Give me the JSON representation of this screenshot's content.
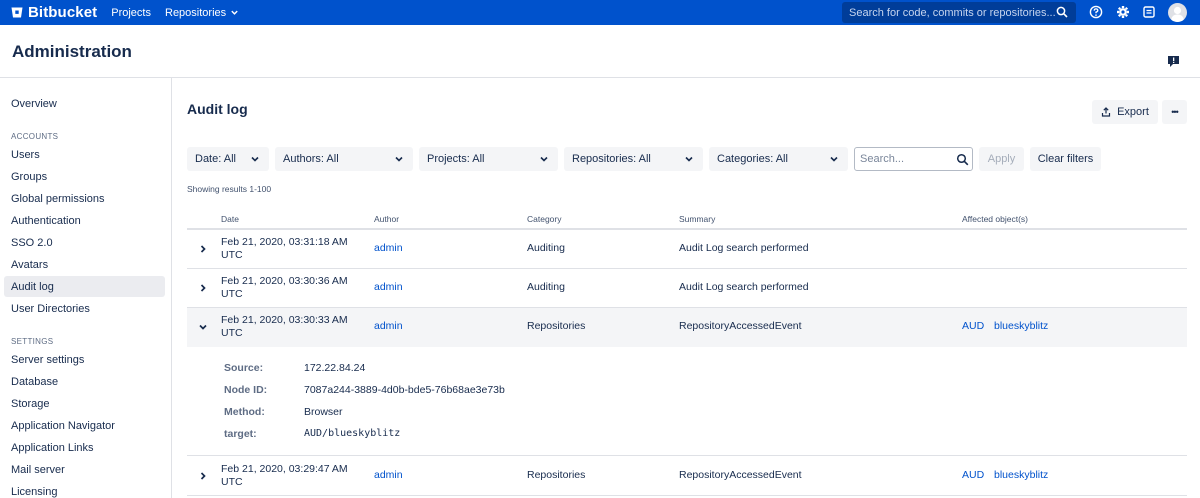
{
  "topnav": {
    "brand": "Bitbucket",
    "projects": "Projects",
    "repositories": "Repositories",
    "search_placeholder": "Search for code, commits or repositories..."
  },
  "admin": {
    "title": "Administration"
  },
  "sidebar": {
    "overview": "Overview",
    "accounts_heading": "ACCOUNTS",
    "accounts": [
      "Users",
      "Groups",
      "Global permissions",
      "Authentication",
      "SSO 2.0",
      "Avatars",
      "Audit log",
      "User Directories"
    ],
    "settings_heading": "SETTINGS",
    "settings": [
      "Server settings",
      "Database",
      "Storage",
      "Application Navigator",
      "Application Links",
      "Mail server",
      "Licensing"
    ],
    "active": "Audit log"
  },
  "main": {
    "title": "Audit log",
    "export_label": "Export",
    "more_label": "•••",
    "filters": {
      "date": "Date: All",
      "authors": "Authors: All",
      "projects": "Projects: All",
      "repositories": "Repositories: All",
      "categories": "Categories: All",
      "search_placeholder": "Search...",
      "apply": "Apply",
      "clear": "Clear filters"
    },
    "showing": "Showing results 1-100",
    "columns": {
      "date": "Date",
      "author": "Author",
      "category": "Category",
      "summary": "Summary",
      "affected": "Affected object(s)"
    },
    "rows": [
      {
        "date": "Feb 21, 2020, 03:31:18 AM",
        "tz": "UTC",
        "author": "admin",
        "category": "Auditing",
        "summary": "Audit Log search performed",
        "obj1": "",
        "obj2": ""
      },
      {
        "date": "Feb 21, 2020, 03:30:36 AM",
        "tz": "UTC",
        "author": "admin",
        "category": "Auditing",
        "summary": "Audit Log search performed",
        "obj1": "",
        "obj2": ""
      },
      {
        "date": "Feb 21, 2020, 03:30:33 AM",
        "tz": "UTC",
        "author": "admin",
        "category": "Repositories",
        "summary": "RepositoryAccessedEvent",
        "obj1": "AUD",
        "obj2": "blueskyblitz"
      },
      {
        "date": "Feb 21, 2020, 03:29:47 AM",
        "tz": "UTC",
        "author": "admin",
        "category": "Repositories",
        "summary": "RepositoryAccessedEvent",
        "obj1": "AUD",
        "obj2": "blueskyblitz"
      }
    ],
    "details": {
      "source_label": "Source:",
      "source": "172.22.84.24",
      "node_label": "Node ID:",
      "node": "7087a244-3889-4d0b-bde5-76b68ae3e73b",
      "method_label": "Method:",
      "method": "Browser",
      "target_label": "target:",
      "target": "AUD/blueskyblitz"
    }
  }
}
